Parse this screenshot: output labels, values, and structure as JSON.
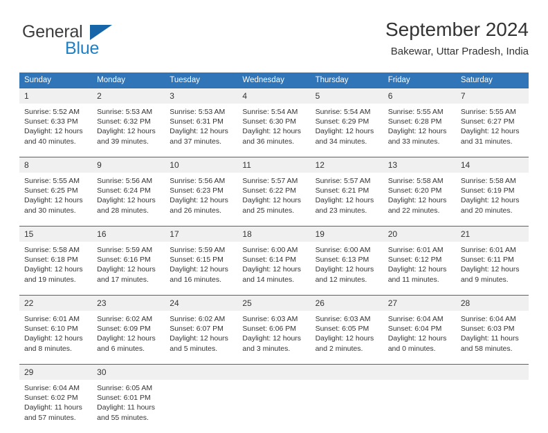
{
  "logo": {
    "word_one": "General",
    "word_two": "Blue",
    "triangle_color": "#1565a8"
  },
  "header": {
    "title": "September 2024",
    "subtitle": "Bakewar, Uttar Pradesh, India"
  },
  "theme": {
    "header_bar_color": "#3075b8",
    "row_divider_color": "#2b6ca8",
    "daynum_band_color": "#f0f0f0",
    "text_color": "#333333"
  },
  "weekday_headers": [
    "Sunday",
    "Monday",
    "Tuesday",
    "Wednesday",
    "Thursday",
    "Friday",
    "Saturday"
  ],
  "labels": {
    "sunrise_prefix": "Sunrise:",
    "sunset_prefix": "Sunset:",
    "daylight_prefix": "Daylight:"
  },
  "weeks": [
    [
      {
        "day": "1",
        "sunrise": "Sunrise: 5:52 AM",
        "sunset": "Sunset: 6:33 PM",
        "daylight_line1": "Daylight: 12 hours",
        "daylight_line2": "and 40 minutes."
      },
      {
        "day": "2",
        "sunrise": "Sunrise: 5:53 AM",
        "sunset": "Sunset: 6:32 PM",
        "daylight_line1": "Daylight: 12 hours",
        "daylight_line2": "and 39 minutes."
      },
      {
        "day": "3",
        "sunrise": "Sunrise: 5:53 AM",
        "sunset": "Sunset: 6:31 PM",
        "daylight_line1": "Daylight: 12 hours",
        "daylight_line2": "and 37 minutes."
      },
      {
        "day": "4",
        "sunrise": "Sunrise: 5:54 AM",
        "sunset": "Sunset: 6:30 PM",
        "daylight_line1": "Daylight: 12 hours",
        "daylight_line2": "and 36 minutes."
      },
      {
        "day": "5",
        "sunrise": "Sunrise: 5:54 AM",
        "sunset": "Sunset: 6:29 PM",
        "daylight_line1": "Daylight: 12 hours",
        "daylight_line2": "and 34 minutes."
      },
      {
        "day": "6",
        "sunrise": "Sunrise: 5:55 AM",
        "sunset": "Sunset: 6:28 PM",
        "daylight_line1": "Daylight: 12 hours",
        "daylight_line2": "and 33 minutes."
      },
      {
        "day": "7",
        "sunrise": "Sunrise: 5:55 AM",
        "sunset": "Sunset: 6:27 PM",
        "daylight_line1": "Daylight: 12 hours",
        "daylight_line2": "and 31 minutes."
      }
    ],
    [
      {
        "day": "8",
        "sunrise": "Sunrise: 5:55 AM",
        "sunset": "Sunset: 6:25 PM",
        "daylight_line1": "Daylight: 12 hours",
        "daylight_line2": "and 30 minutes."
      },
      {
        "day": "9",
        "sunrise": "Sunrise: 5:56 AM",
        "sunset": "Sunset: 6:24 PM",
        "daylight_line1": "Daylight: 12 hours",
        "daylight_line2": "and 28 minutes."
      },
      {
        "day": "10",
        "sunrise": "Sunrise: 5:56 AM",
        "sunset": "Sunset: 6:23 PM",
        "daylight_line1": "Daylight: 12 hours",
        "daylight_line2": "and 26 minutes."
      },
      {
        "day": "11",
        "sunrise": "Sunrise: 5:57 AM",
        "sunset": "Sunset: 6:22 PM",
        "daylight_line1": "Daylight: 12 hours",
        "daylight_line2": "and 25 minutes."
      },
      {
        "day": "12",
        "sunrise": "Sunrise: 5:57 AM",
        "sunset": "Sunset: 6:21 PM",
        "daylight_line1": "Daylight: 12 hours",
        "daylight_line2": "and 23 minutes."
      },
      {
        "day": "13",
        "sunrise": "Sunrise: 5:58 AM",
        "sunset": "Sunset: 6:20 PM",
        "daylight_line1": "Daylight: 12 hours",
        "daylight_line2": "and 22 minutes."
      },
      {
        "day": "14",
        "sunrise": "Sunrise: 5:58 AM",
        "sunset": "Sunset: 6:19 PM",
        "daylight_line1": "Daylight: 12 hours",
        "daylight_line2": "and 20 minutes."
      }
    ],
    [
      {
        "day": "15",
        "sunrise": "Sunrise: 5:58 AM",
        "sunset": "Sunset: 6:18 PM",
        "daylight_line1": "Daylight: 12 hours",
        "daylight_line2": "and 19 minutes."
      },
      {
        "day": "16",
        "sunrise": "Sunrise: 5:59 AM",
        "sunset": "Sunset: 6:16 PM",
        "daylight_line1": "Daylight: 12 hours",
        "daylight_line2": "and 17 minutes."
      },
      {
        "day": "17",
        "sunrise": "Sunrise: 5:59 AM",
        "sunset": "Sunset: 6:15 PM",
        "daylight_line1": "Daylight: 12 hours",
        "daylight_line2": "and 16 minutes."
      },
      {
        "day": "18",
        "sunrise": "Sunrise: 6:00 AM",
        "sunset": "Sunset: 6:14 PM",
        "daylight_line1": "Daylight: 12 hours",
        "daylight_line2": "and 14 minutes."
      },
      {
        "day": "19",
        "sunrise": "Sunrise: 6:00 AM",
        "sunset": "Sunset: 6:13 PM",
        "daylight_line1": "Daylight: 12 hours",
        "daylight_line2": "and 12 minutes."
      },
      {
        "day": "20",
        "sunrise": "Sunrise: 6:01 AM",
        "sunset": "Sunset: 6:12 PM",
        "daylight_line1": "Daylight: 12 hours",
        "daylight_line2": "and 11 minutes."
      },
      {
        "day": "21",
        "sunrise": "Sunrise: 6:01 AM",
        "sunset": "Sunset: 6:11 PM",
        "daylight_line1": "Daylight: 12 hours",
        "daylight_line2": "and 9 minutes."
      }
    ],
    [
      {
        "day": "22",
        "sunrise": "Sunrise: 6:01 AM",
        "sunset": "Sunset: 6:10 PM",
        "daylight_line1": "Daylight: 12 hours",
        "daylight_line2": "and 8 minutes."
      },
      {
        "day": "23",
        "sunrise": "Sunrise: 6:02 AM",
        "sunset": "Sunset: 6:09 PM",
        "daylight_line1": "Daylight: 12 hours",
        "daylight_line2": "and 6 minutes."
      },
      {
        "day": "24",
        "sunrise": "Sunrise: 6:02 AM",
        "sunset": "Sunset: 6:07 PM",
        "daylight_line1": "Daylight: 12 hours",
        "daylight_line2": "and 5 minutes."
      },
      {
        "day": "25",
        "sunrise": "Sunrise: 6:03 AM",
        "sunset": "Sunset: 6:06 PM",
        "daylight_line1": "Daylight: 12 hours",
        "daylight_line2": "and 3 minutes."
      },
      {
        "day": "26",
        "sunrise": "Sunrise: 6:03 AM",
        "sunset": "Sunset: 6:05 PM",
        "daylight_line1": "Daylight: 12 hours",
        "daylight_line2": "and 2 minutes."
      },
      {
        "day": "27",
        "sunrise": "Sunrise: 6:04 AM",
        "sunset": "Sunset: 6:04 PM",
        "daylight_line1": "Daylight: 12 hours",
        "daylight_line2": "and 0 minutes."
      },
      {
        "day": "28",
        "sunrise": "Sunrise: 6:04 AM",
        "sunset": "Sunset: 6:03 PM",
        "daylight_line1": "Daylight: 11 hours",
        "daylight_line2": "and 58 minutes."
      }
    ],
    [
      {
        "day": "29",
        "sunrise": "Sunrise: 6:04 AM",
        "sunset": "Sunset: 6:02 PM",
        "daylight_line1": "Daylight: 11 hours",
        "daylight_line2": "and 57 minutes."
      },
      {
        "day": "30",
        "sunrise": "Sunrise: 6:05 AM",
        "sunset": "Sunset: 6:01 PM",
        "daylight_line1": "Daylight: 11 hours",
        "daylight_line2": "and 55 minutes."
      },
      {
        "day": "",
        "sunrise": "",
        "sunset": "",
        "daylight_line1": "",
        "daylight_line2": ""
      },
      {
        "day": "",
        "sunrise": "",
        "sunset": "",
        "daylight_line1": "",
        "daylight_line2": ""
      },
      {
        "day": "",
        "sunrise": "",
        "sunset": "",
        "daylight_line1": "",
        "daylight_line2": ""
      },
      {
        "day": "",
        "sunrise": "",
        "sunset": "",
        "daylight_line1": "",
        "daylight_line2": ""
      },
      {
        "day": "",
        "sunrise": "",
        "sunset": "",
        "daylight_line1": "",
        "daylight_line2": ""
      }
    ]
  ]
}
